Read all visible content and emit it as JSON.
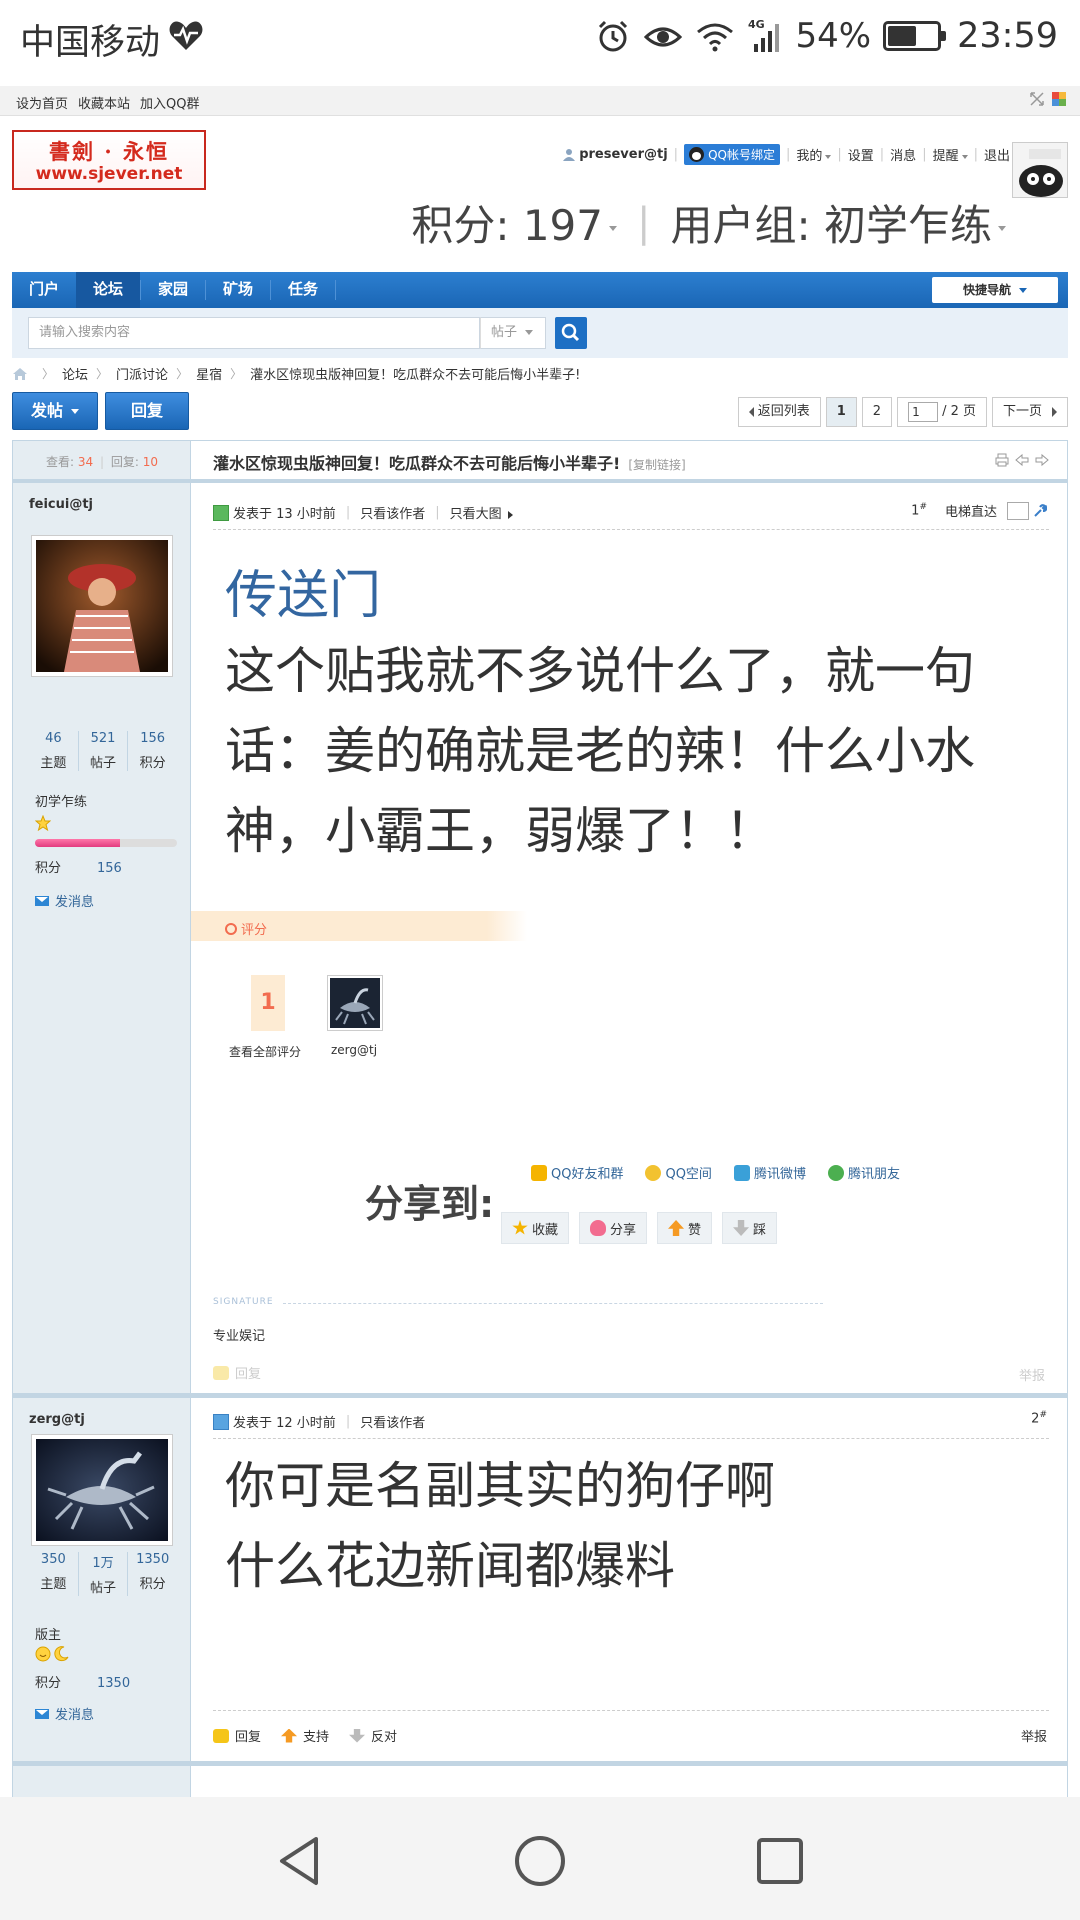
{
  "status_bar": {
    "carrier": "中国移动",
    "battery_pct": "54%",
    "time": "23:59",
    "network": "4G"
  },
  "top_links": [
    "设为首页",
    "收藏本站",
    "加入QQ群"
  ],
  "logo": {
    "line1": "書劍 · 永恒",
    "line2": "www.sjever.net"
  },
  "user_nav": {
    "username": "presever@tj",
    "qq_bind": "QQ帐号绑定",
    "items": [
      "我的",
      "设置",
      "消息",
      "提醒",
      "退出"
    ]
  },
  "credits": {
    "score": "积分: 197",
    "group": "用户组: 初学乍练"
  },
  "nav": {
    "items": [
      "门户",
      "论坛",
      "家园",
      "矿场",
      "任务"
    ],
    "active": "论坛",
    "quick_nav": "快捷导航"
  },
  "search": {
    "placeholder": "请输入搜索内容",
    "type": "帖子"
  },
  "breadcrumb": [
    "论坛",
    "门派讨论",
    "星宿",
    "灌水区惊现虫版神回复！吃瓜群众不去可能后悔小半辈子!"
  ],
  "actions": {
    "post": "发帖",
    "reply": "回复"
  },
  "pager": {
    "back": "返回列表",
    "pages": [
      "1",
      "2"
    ],
    "current": "1",
    "input": "1",
    "total": "/ 2 页",
    "next": "下一页"
  },
  "thread": {
    "views_label": "查看:",
    "views": "34",
    "replies_label": "回复:",
    "replies": "10",
    "title": "灌水区惊现虫版神回复！吃瓜群众不去可能后悔小半辈子!",
    "copy_link": "[复制链接]"
  },
  "post1": {
    "author": "feicui@tj",
    "stats": [
      {
        "n": "46",
        "l": "主题"
      },
      {
        "n": "521",
        "l": "帖子"
      },
      {
        "n": "156",
        "l": "积分"
      }
    ],
    "rank": "初学乍练",
    "level_progress": 0.6,
    "score_label": "积分",
    "score": "156",
    "send_msg": "发消息",
    "meta": {
      "time": "发表于 13 小时前",
      "only_author": "只看该作者",
      "big_img": "只看大图"
    },
    "floor": "1",
    "floor_sup": "#",
    "elevator": "电梯直达",
    "link_text": "传送门",
    "content": [
      "这个贴我就不多说什么了，就一句",
      "话：姜的确就是老的辣！什么小水",
      "神，小霸王，弱爆了！！"
    ],
    "rate_label": "评分",
    "rate_count": "1",
    "rate_all": "查看全部评分",
    "rater": "zerg@tj",
    "share_title": "分享到:",
    "share_links": [
      "QQ好友和群",
      "QQ空间",
      "腾讯微博",
      "腾讯朋友"
    ],
    "action_buttons": [
      "收藏",
      "分享",
      "赞",
      "踩"
    ],
    "signature_label": "SIGNATURE",
    "signature": "专业娱记",
    "reply": "回复",
    "report": "举报"
  },
  "post2": {
    "author": "zerg@tj",
    "stats": [
      {
        "n": "350",
        "l": "主题"
      },
      {
        "n": "1万",
        "l": "帖子"
      },
      {
        "n": "1350",
        "l": "积分"
      }
    ],
    "rank": "版主",
    "score_label": "积分",
    "score": "1350",
    "send_msg": "发消息",
    "meta": {
      "time": "发表于 12 小时前",
      "only_author": "只看该作者"
    },
    "floor": "2",
    "floor_sup": "#",
    "content": [
      "你可是名副其实的狗仔啊",
      "什么花边新闻都爆料"
    ],
    "footer": [
      "回复",
      "支持",
      "反对"
    ],
    "report": "举报"
  },
  "colors": {
    "nav_blue": "#1a66b5",
    "accent_orange": "#f26c4f",
    "side_bg": "#e5edf2"
  }
}
